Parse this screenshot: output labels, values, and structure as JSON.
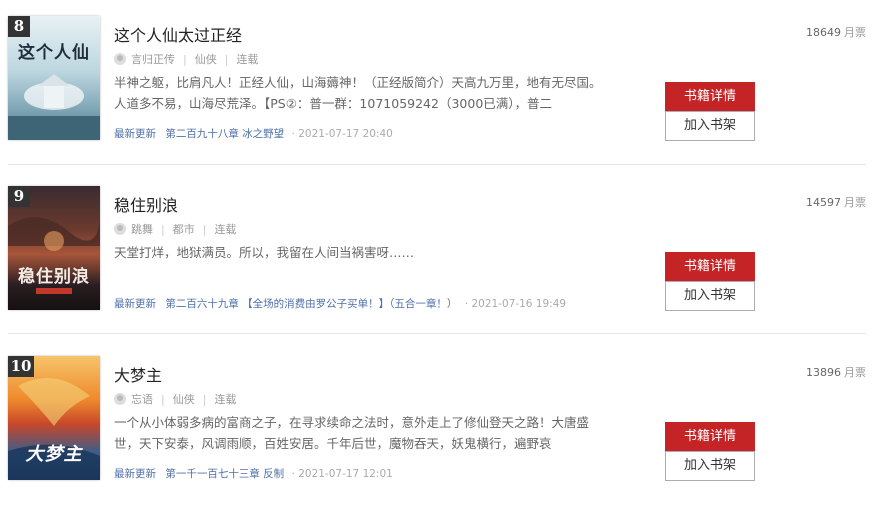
{
  "books": [
    {
      "rank": "8",
      "title": "这个人仙太过正经",
      "author": "言归正传",
      "genre": "仙侠",
      "status": "连载",
      "intro": "半神之躯，比肩凡人！正经人仙，山海薅神！（正经版简介）天高九万里，地有无尽国。人道多不易，山海尽荒泽。【PS②：普一群：1071059242（3000已满），普二",
      "update_label": "最新更新",
      "update_chapter": "第二百九十八章 冰之野望",
      "update_time": "· 2021-07-17 20:40",
      "votes": "18649",
      "votes_unit": "月票",
      "detail_label": "书籍详情",
      "shelf_label": "加入书架",
      "cover_text": "这个人仙",
      "cover_colors": [
        "#cfe3ea",
        "#5b8aa0"
      ]
    },
    {
      "rank": "9",
      "title": "稳住别浪",
      "author": "跳舞",
      "genre": "都市",
      "status": "连载",
      "intro": "天堂打烊，地狱满员。所以，我留在人间当祸害呀……",
      "update_label": "最新更新",
      "update_chapter": "第二百六十九章 【全场的消费由罗公子买单！】（五合一章！）",
      "update_time": "· 2021-07-16 19:49",
      "votes": "14597",
      "votes_unit": "月票",
      "detail_label": "书籍详情",
      "shelf_label": "加入书架",
      "cover_text": "稳住别浪",
      "cover_colors": [
        "#2a1e22",
        "#d06a3a"
      ]
    },
    {
      "rank": "10",
      "title": "大梦主",
      "author": "忘语",
      "genre": "仙侠",
      "status": "连载",
      "intro": "一个从小体弱多病的富商之子，在寻求续命之法时，意外走上了修仙登天之路！大唐盛世，天下安泰，风调雨顺，百姓安居。千年后世，魔物吞天，妖鬼横行，遍野哀",
      "update_label": "最新更新",
      "update_chapter": "第一千一百七十三章 反制",
      "update_time": "· 2021-07-17 12:01",
      "votes": "13896",
      "votes_unit": "月票",
      "detail_label": "书籍详情",
      "shelf_label": "加入书架",
      "cover_text": "大梦主",
      "cover_colors": [
        "#f3a23a",
        "#2a5b8f"
      ]
    }
  ]
}
